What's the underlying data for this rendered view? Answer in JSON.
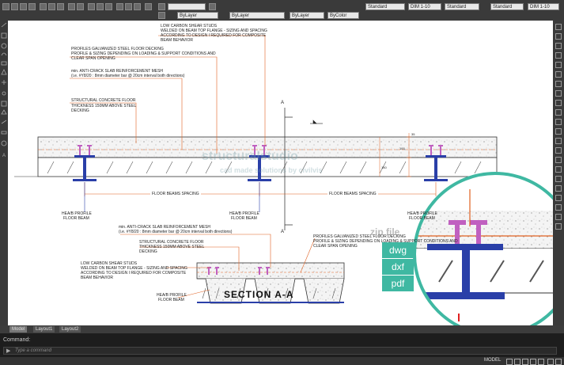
{
  "toolbar": {
    "layer_label": "ByLayer",
    "linetype_label": "ByLayer",
    "lineweight_label": "ByLayer",
    "color_label": "ByColor",
    "text_style": "Standard",
    "dim_style": "DIM 1-10",
    "table_style": "Standard",
    "mleader_style": "Standard",
    "scale_right": "DIM 1-10"
  },
  "drawing": {
    "notes_top": [
      "LOW CARBON SHEAR STUDS",
      "WELDED ON BEAM TOP FLANGE - SIZING AND SPACING",
      "ACCORDING TO DESIGN I REQUIRED FOR COMPOSITE",
      "BEAM BEHAVIOR",
      "PROFILES GALVANIZED STEEL FLOOR DECKING",
      "PROFILE & SIZING DEPENDING ON LOADING & SUPPORT CONDITIONS AND",
      "CLEAR SPAN OPENING",
      "min. ANTI-CRACK SLAB REINFORCEMENT MESH",
      "(i.e. #Y8/20 : 8mm diameter bar @ 20cm interval both directions)",
      "STRUCTURAL CONCRETE FLOOR",
      "THICKNESS 150mm ABOVE STEEL",
      "DECKING"
    ],
    "section_marker": "A",
    "spacing_label": "FLOOR BEAMS SPACING",
    "beam_label_1": "HEA/B PROFILE",
    "beam_label_2": "FLOOR BEAM",
    "dims": [
      "35",
      "100",
      "150"
    ],
    "notes_bottom_left": [
      "min. ANTI-CRACK SLAB REINFORCEMENT MESH",
      "(i.e. #Y8/20 : 8mm diameter bar @ 20cm interval both directions)",
      "STRUCTURAL CONCRETE FLOOR",
      "THICKNESS 150mm ABOVE STEEL",
      "DECKING",
      "LOW CARBON SHEAR STUDS",
      "WELDED ON BEAM TOP FLANGE - SIZING AND SPACING",
      "ACCORDING TO DESIGN I REQUIRED FOR COMPOSITE",
      "BEAM BEHAVIOR"
    ],
    "notes_bottom_right": [
      "PROFILES GALVANIZED STEEL FLOOR DECKING",
      "PROFILE & SIZING DEPENDING ON LOADING & SUPPORT CONDITIONS AND",
      "CLEAR SPAN OPENING"
    ],
    "section_title": "SECTION  A-A",
    "watermark_main": "structuralstudio",
    "watermark_sub": "cad made solutions by civilvis",
    "zip_label": "zip file",
    "badges": [
      "dwg",
      "dxf",
      "pdf"
    ]
  },
  "tabs": [
    "Model",
    "Layout1",
    "Layout2"
  ],
  "command": {
    "history": "Command:",
    "prompt": "Type a command"
  },
  "status": {
    "mode": "MODEL"
  },
  "colors": {
    "beam_blue": "#2a3fa8",
    "stud_magenta": "#c060c0",
    "leader_orange": "#e06020",
    "accent_teal": "#3fb8a2"
  }
}
